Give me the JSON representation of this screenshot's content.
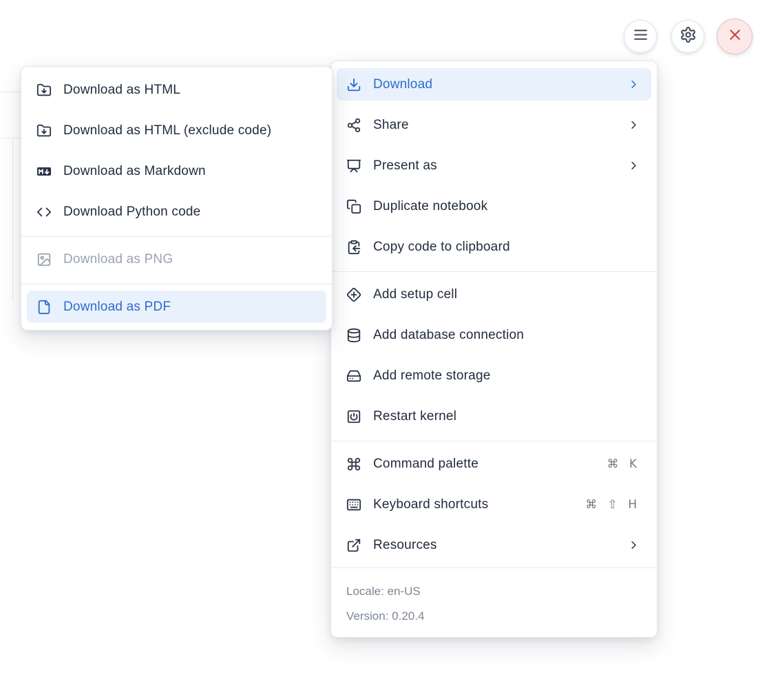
{
  "header": {
    "buttons": [
      {
        "name": "notebook-actions",
        "icon": "hamburger-icon"
      },
      {
        "name": "settings",
        "icon": "gear-icon"
      },
      {
        "name": "shutdown",
        "icon": "x-icon"
      }
    ]
  },
  "main_menu": {
    "sections": [
      {
        "items": [
          {
            "label": "Download",
            "icon": "download-icon",
            "submenu": true,
            "highlighted": true
          },
          {
            "label": "Share",
            "icon": "share-icon",
            "submenu": true
          },
          {
            "label": "Present as",
            "icon": "presentation-icon",
            "submenu": true
          },
          {
            "label": "Duplicate notebook",
            "icon": "copy-icon"
          },
          {
            "label": "Copy code to clipboard",
            "icon": "clipboard-copy-icon"
          }
        ]
      },
      {
        "items": [
          {
            "label": "Add setup cell",
            "icon": "diamond-plus-icon"
          },
          {
            "label": "Add database connection",
            "icon": "database-icon"
          },
          {
            "label": "Add remote storage",
            "icon": "hard-drive-icon"
          },
          {
            "label": "Restart kernel",
            "icon": "square-power-icon"
          }
        ]
      },
      {
        "items": [
          {
            "label": "Command palette",
            "icon": "command-icon",
            "shortcut": "⌘ K"
          },
          {
            "label": "Keyboard shortcuts",
            "icon": "keyboard-icon",
            "shortcut": "⌘ ⇧ H"
          },
          {
            "label": "Resources",
            "icon": "external-link-icon",
            "submenu": true
          }
        ]
      }
    ],
    "footer": {
      "locale": "Locale: en-US",
      "version": "Version: 0.20.4"
    }
  },
  "download_submenu": {
    "sections": [
      {
        "items": [
          {
            "label": "Download as HTML",
            "icon": "folder-down-icon"
          },
          {
            "label": "Download as HTML (exclude code)",
            "icon": "folder-down-icon"
          },
          {
            "label": "Download as Markdown",
            "icon": "markdown-badge-icon"
          },
          {
            "label": "Download Python code",
            "icon": "code-icon"
          }
        ]
      },
      {
        "items": [
          {
            "label": "Download as PNG",
            "icon": "image-icon",
            "disabled": true
          }
        ]
      },
      {
        "items": [
          {
            "label": "Download as PDF",
            "icon": "file-icon",
            "highlighted": true
          }
        ]
      }
    ]
  },
  "colors": {
    "accent_blue": "#2c6ccd",
    "highlight_bg": "#e9f1fc",
    "text": "#212c3e",
    "disabled": "#9aa3b1",
    "muted": "#7c8695",
    "divider": "#e7eaee",
    "danger": "#cd4040",
    "danger_bg": "#fbe9e9",
    "danger_border": "#efbcbc"
  }
}
